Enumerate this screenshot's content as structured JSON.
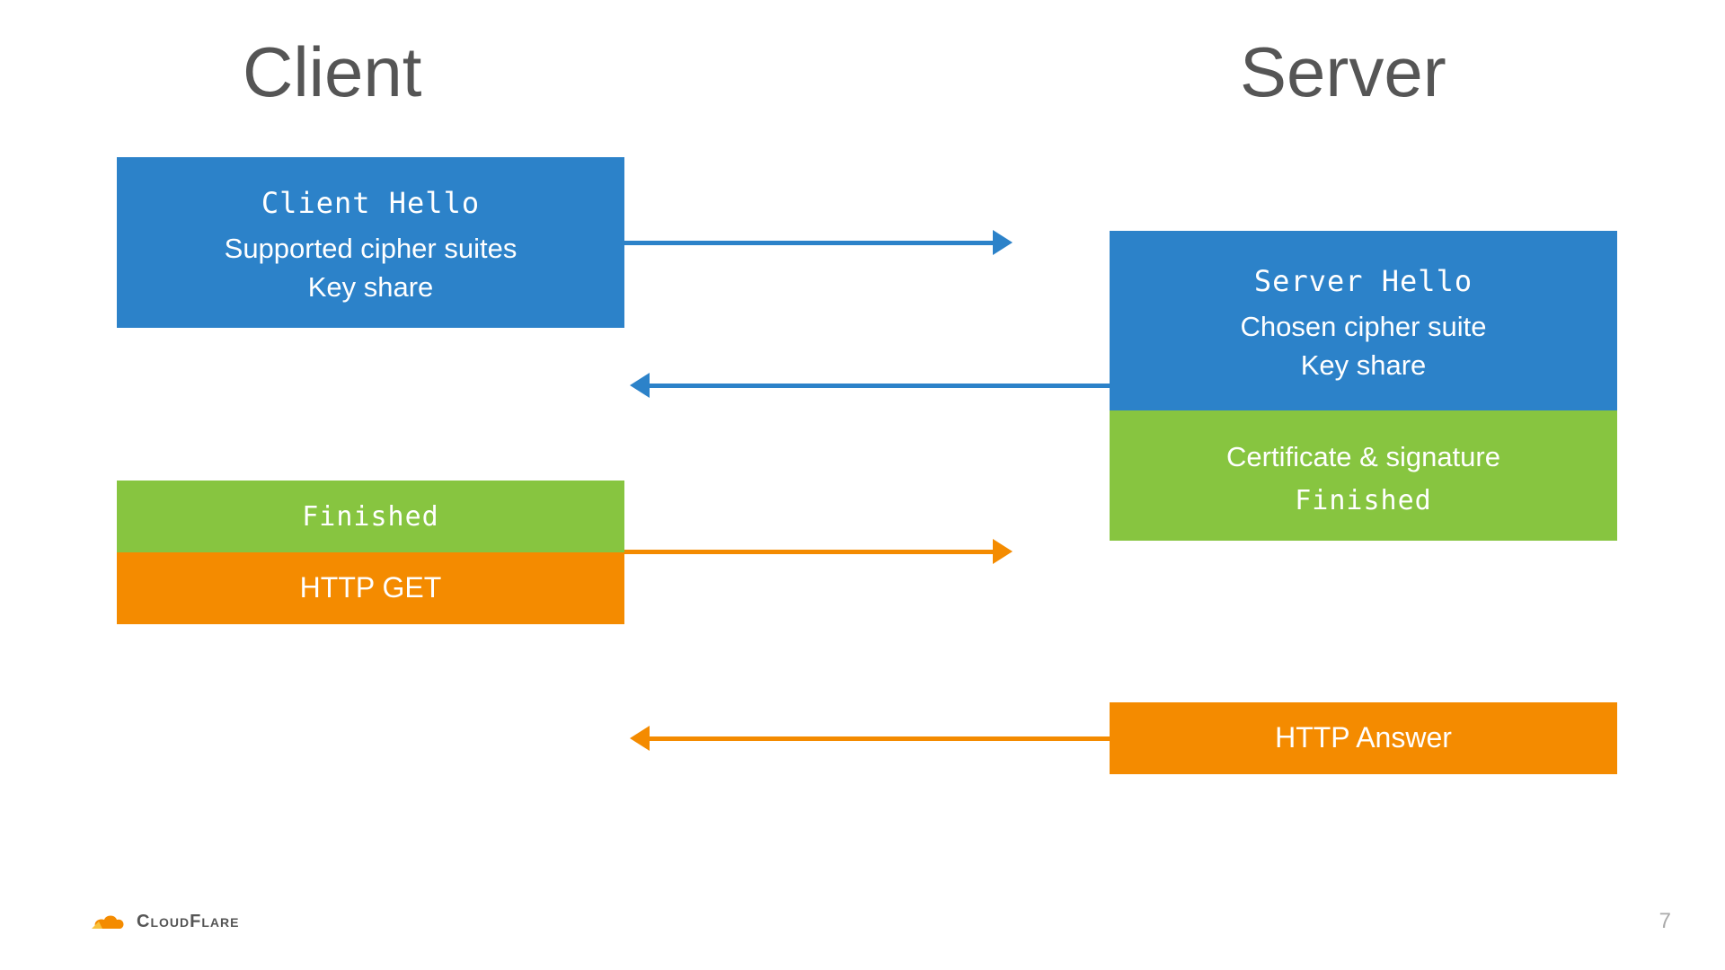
{
  "headings": {
    "client": "Client",
    "server": "Server"
  },
  "client_hello": {
    "title": "Client Hello",
    "sub1": "Supported cipher suites",
    "sub2": "Key share"
  },
  "server_hello": {
    "title": "Server Hello",
    "sub1": "Chosen cipher suite",
    "sub2": "Key share"
  },
  "server_cert": {
    "line1": "Certificate & signature",
    "line2": "Finished"
  },
  "client_finished": {
    "label": "Finished"
  },
  "http_get": {
    "label": "HTTP GET"
  },
  "http_answer": {
    "label": "HTTP Answer"
  },
  "logo": {
    "text": "CloudFlare"
  },
  "page_number": "7",
  "colors": {
    "blue": "#2c82c9",
    "green": "#87c540",
    "orange": "#f48b00"
  }
}
